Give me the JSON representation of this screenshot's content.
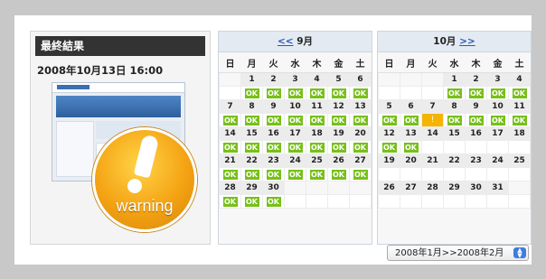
{
  "result": {
    "title": "最終結果",
    "datetime": "2008年10月13日 16:00",
    "warning_label": "warning"
  },
  "calendar_sep": {
    "prev_label": "<<",
    "month_label": "9月",
    "weekdays": [
      "日",
      "月",
      "火",
      "水",
      "木",
      "金",
      "土"
    ],
    "rows": [
      {
        "days": [
          "",
          "1",
          "2",
          "3",
          "4",
          "5",
          "6"
        ],
        "status": [
          "",
          "OK",
          "OK",
          "OK",
          "OK",
          "OK",
          "OK"
        ]
      },
      {
        "days": [
          "7",
          "8",
          "9",
          "10",
          "11",
          "12",
          "13"
        ],
        "status": [
          "OK",
          "OK",
          "OK",
          "OK",
          "OK",
          "OK",
          "OK"
        ]
      },
      {
        "days": [
          "14",
          "15",
          "16",
          "17",
          "18",
          "19",
          "20"
        ],
        "status": [
          "OK",
          "OK",
          "OK",
          "OK",
          "OK",
          "OK",
          "OK"
        ]
      },
      {
        "days": [
          "21",
          "22",
          "23",
          "24",
          "25",
          "26",
          "27"
        ],
        "status": [
          "OK",
          "OK",
          "OK",
          "OK",
          "OK",
          "OK",
          "OK"
        ]
      },
      {
        "days": [
          "28",
          "29",
          "30",
          "",
          "",
          "",
          ""
        ],
        "status": [
          "OK",
          "OK",
          "OK",
          "",
          "",
          "",
          ""
        ]
      }
    ]
  },
  "calendar_oct": {
    "month_label": "10月",
    "next_label": ">>",
    "weekdays": [
      "日",
      "月",
      "火",
      "水",
      "木",
      "金",
      "土"
    ],
    "rows": [
      {
        "days": [
          "",
          "",
          "",
          "1",
          "2",
          "3",
          "4"
        ],
        "status": [
          "",
          "",
          "",
          "OK",
          "OK",
          "OK",
          "OK"
        ]
      },
      {
        "days": [
          "5",
          "6",
          "7",
          "8",
          "9",
          "10",
          "11"
        ],
        "status": [
          "OK",
          "OK",
          "!",
          "OK",
          "OK",
          "OK",
          "OK"
        ]
      },
      {
        "days": [
          "12",
          "13",
          "14",
          "15",
          "16",
          "17",
          "18"
        ],
        "status": [
          "OK",
          "OK",
          "",
          "",
          "",
          "",
          ""
        ]
      },
      {
        "days": [
          "19",
          "20",
          "21",
          "22",
          "23",
          "24",
          "25"
        ],
        "status": [
          "",
          "",
          "",
          "",
          "",
          "",
          ""
        ]
      },
      {
        "days": [
          "26",
          "27",
          "28",
          "29",
          "30",
          "31",
          ""
        ],
        "status": [
          "",
          "",
          "",
          "",
          "",
          "",
          ""
        ]
      }
    ]
  },
  "range_select": {
    "value": "2008年1月>>2008年2月"
  },
  "colors": {
    "ok": "#77c01a",
    "warning": "#f5b400",
    "header": "#333333"
  }
}
